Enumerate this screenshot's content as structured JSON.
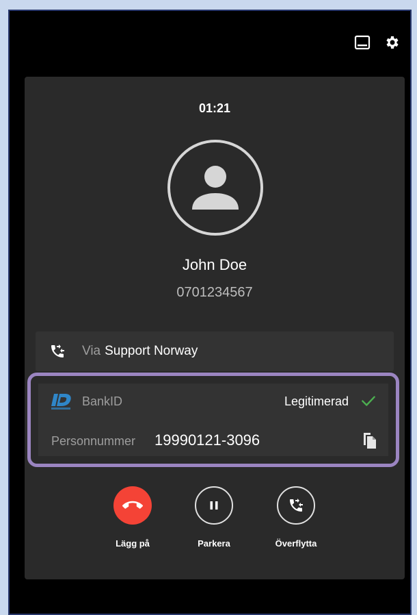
{
  "call": {
    "timer": "01:21",
    "caller_name": "John Doe",
    "caller_number": "0701234567"
  },
  "via": {
    "label": "Via",
    "value": "Support Norway"
  },
  "bankid": {
    "label": "BankID",
    "status": "Legitimerad",
    "personnummer_label": "Personnummer",
    "personnummer_value": "19990121-3096"
  },
  "actions": {
    "hangup_label": "Lägg på",
    "park_label": "Parkera",
    "transfer_label": "Överflytta"
  },
  "icons": {
    "top_left": "screen-icon",
    "top_right": "gear-icon",
    "avatar": "person-icon",
    "via": "phone-forward-icon",
    "bankid": "bankid-logo",
    "status": "check-icon",
    "copy": "copy-icon",
    "hangup": "phone-hangup-icon",
    "park": "pause-icon",
    "transfer": "phone-forward-icon"
  },
  "colors": {
    "hangup": "#f44336",
    "check": "#4caf50",
    "highlight": "#9b85c1"
  }
}
